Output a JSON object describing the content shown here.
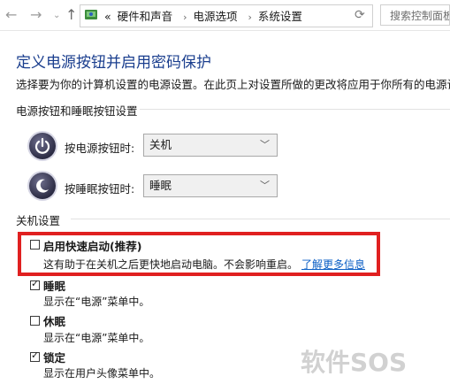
{
  "address_bar": {
    "breadcrumbs": [
      "硬件和声音",
      "电源选项",
      "系统设置"
    ],
    "overflow_chevron": "«",
    "search_placeholder": "搜索控制面板"
  },
  "page": {
    "title": "定义电源按钮并启用密码保护",
    "description": "选择要为你的计算机设置的电源设置。在此页上对设置所做的更改将应用于你所有的电源计划"
  },
  "power_buttons_section": {
    "title": "电源按钮和睡眠按钮设置",
    "power_button_label": "按电源按钮时:",
    "power_button_value": "关机",
    "sleep_button_label": "按睡眠按钮时:",
    "sleep_button_value": "睡眠"
  },
  "shutdown_section": {
    "title": "关机设置",
    "options": [
      {
        "label": "启用快速启动(推荐)",
        "desc": "这有助于在关机之后更快地启动电脑。不会影响重启。",
        "link": "了解更多信息",
        "checked": false
      },
      {
        "label": "睡眠",
        "desc": "显示在“电源”菜单中。",
        "checked": true
      },
      {
        "label": "休眠",
        "desc": "显示在“电源”菜单中。",
        "checked": false
      },
      {
        "label": "锁定",
        "desc": "显示在用户头像菜单中。",
        "checked": true
      }
    ]
  },
  "watermark": "软件SOS",
  "colors": {
    "title": "#1a3e8e",
    "link": "#0a5ec5",
    "highlight": "#e02020"
  },
  "icons": [
    "back-arrow-icon",
    "forward-arrow-icon",
    "up-arrow-icon",
    "control-panel-icon",
    "refresh-icon",
    "power-icon",
    "sleep-icon",
    "chevron-down-icon",
    "checkbox-icon"
  ]
}
